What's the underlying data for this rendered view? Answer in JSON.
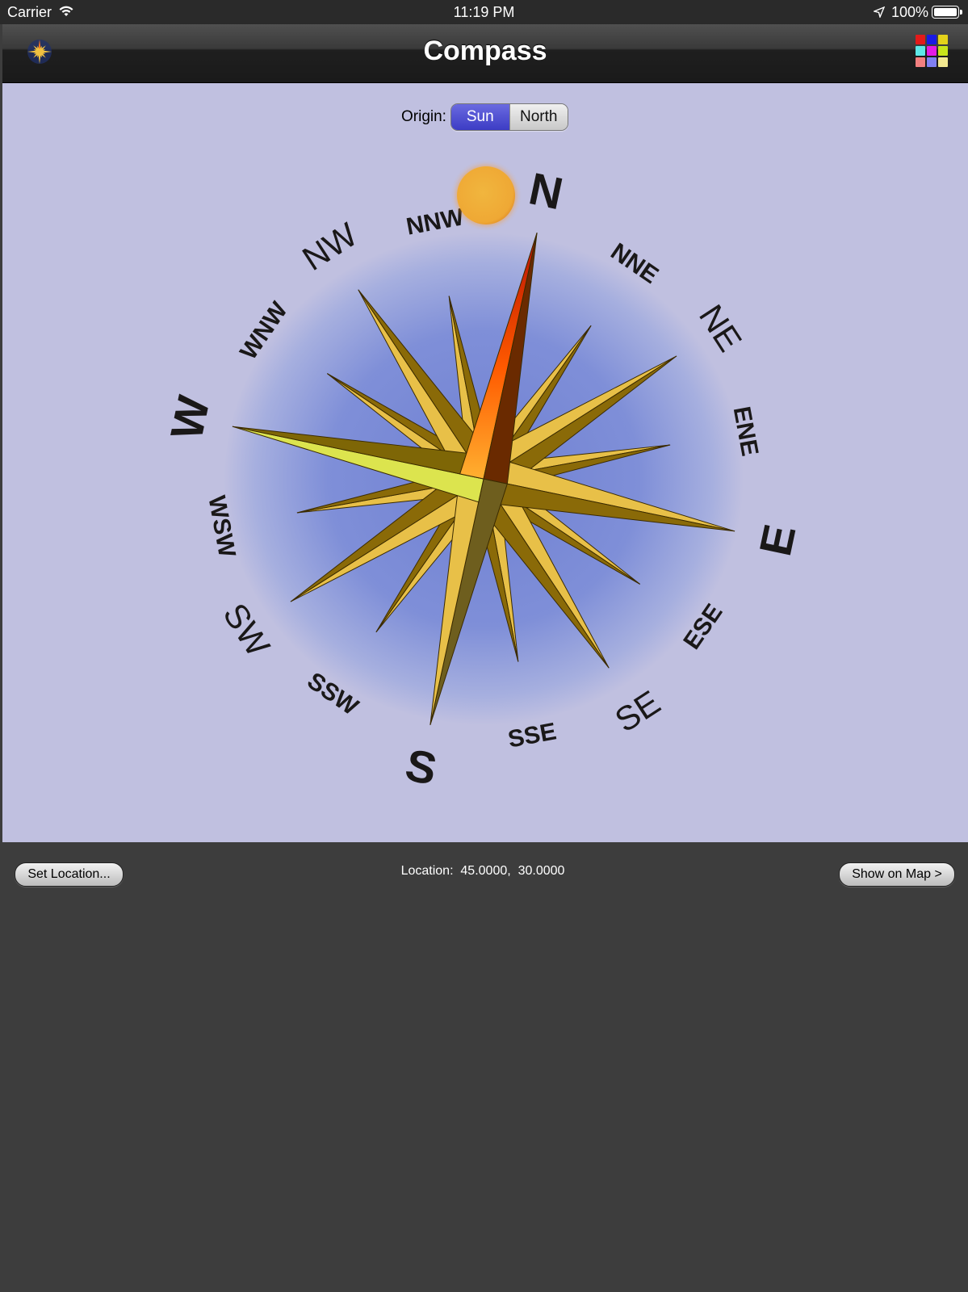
{
  "status_bar": {
    "carrier": "Carrier",
    "time": "11:19 PM",
    "battery": "100%",
    "icons": [
      "wifi-icon",
      "location-arrow-icon",
      "battery-icon"
    ]
  },
  "navbar": {
    "title": "Compass",
    "left_icon": "compass-rose-icon",
    "right_icon": "color-palette-grid-icon",
    "palette_colors": [
      "#e41a1a",
      "#1a1ae4",
      "#e4d21a",
      "#5ee8e8",
      "#e41ae4",
      "#c8e41a",
      "#f28080",
      "#8080f2",
      "#f2e890"
    ]
  },
  "origin": {
    "label": "Origin:",
    "options": [
      "Sun",
      "North"
    ],
    "selected": "Sun"
  },
  "compass": {
    "sun_icon": "sun-icon",
    "cardinals": [
      "N",
      "E",
      "S",
      "W"
    ],
    "intercardinals": [
      "NE",
      "SE",
      "SW",
      "NW"
    ],
    "secondary": [
      "NNE",
      "ENE",
      "ESE",
      "SSE",
      "SSW",
      "WSW",
      "WNW",
      "NNW"
    ],
    "colors": {
      "background": "#c0c0e0",
      "glow": "#7080d0",
      "gold": "#e8c048",
      "gold_dark": "#8a6a08",
      "north_needle": "#ff5a00"
    }
  },
  "bottom": {
    "set_location_label": "Set Location...",
    "location_text": "Location:  45.0000,  30.0000",
    "show_on_map_label": "Show on Map >"
  }
}
